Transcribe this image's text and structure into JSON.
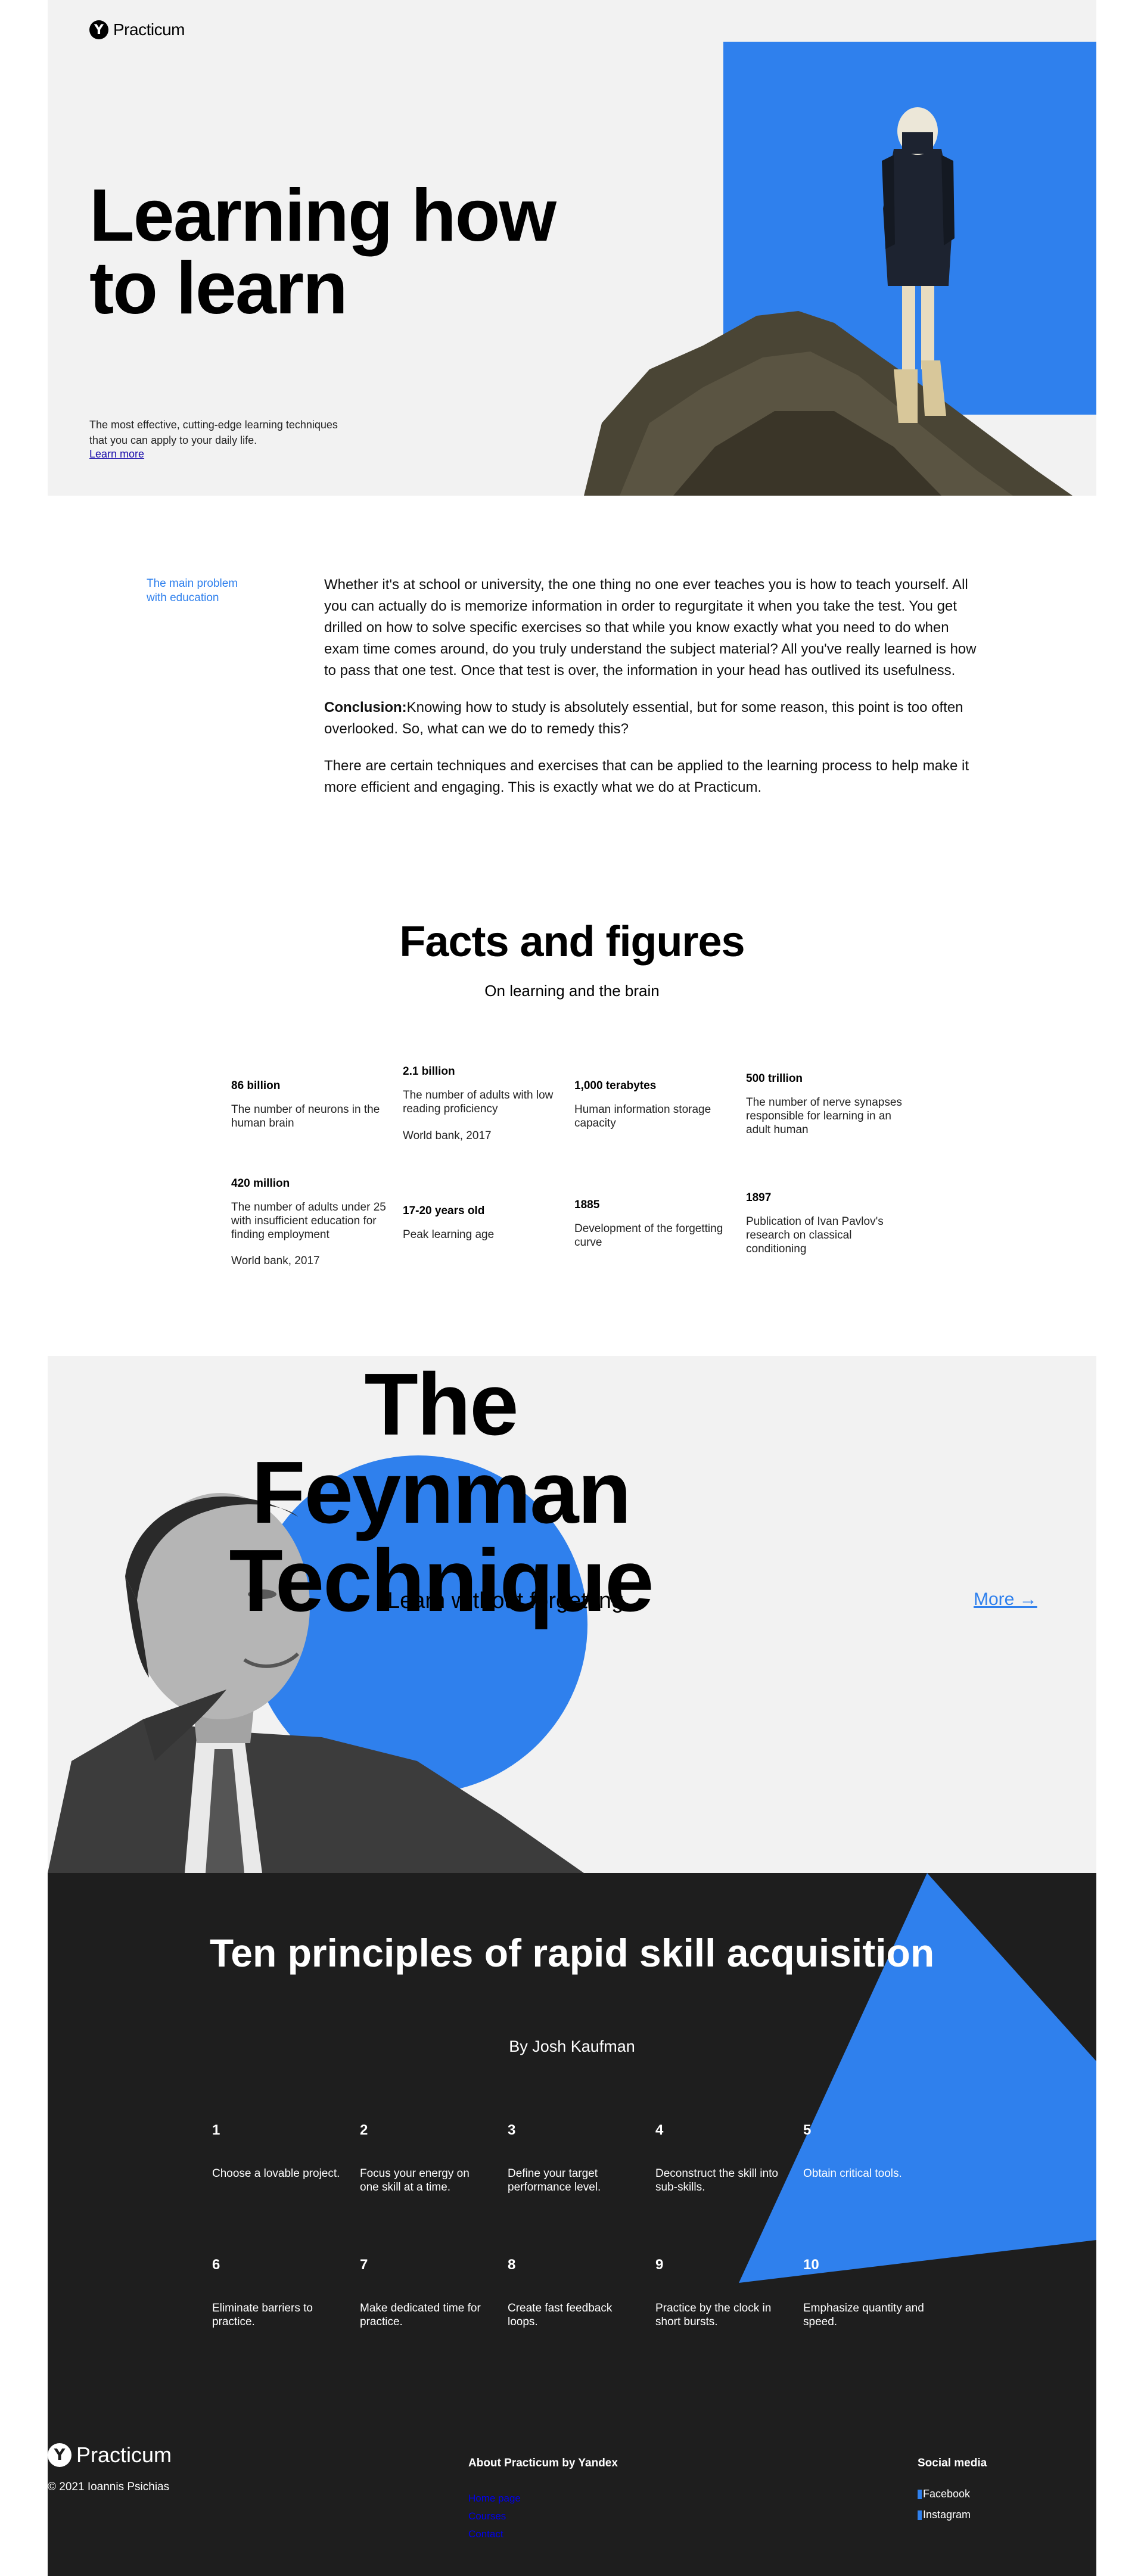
{
  "brand": {
    "name": "Practicum",
    "mark": "Y"
  },
  "hero": {
    "title": "Learning how to learn",
    "subtitle": "The most effective, cutting-edge learning techniques that you can apply to your daily life.",
    "link": "Learn more"
  },
  "problem": {
    "label": "The main problem with education",
    "p1": "Whether it's at school or university, the one thing no one ever teaches you is how to teach yourself. All you can actually do is memorize information in order to regurgitate it when you take the test. You get drilled on how to solve specific exercises so that while you know exactly what you need to do when exam time comes around, do you truly understand the subject material? All you've really learned is how to pass that one test. Once that test is over, the information in your head has outlived its usefulness.",
    "conclusion_label": "Conclusion:",
    "conclusion_text": "Knowing how to study is absolutely essential, but for some reason, this point is too often overlooked. So, what can we do to remedy this?",
    "p3": "There are certain techniques and exercises that can be applied to the learning process to help make it more efficient and engaging. This is exactly what we do at Practicum."
  },
  "facts": {
    "title": "Facts and figures",
    "subtitle": "On learning and the brain",
    "items": [
      {
        "head": "86 billion",
        "desc": "The number of neurons in the human brain",
        "source": ""
      },
      {
        "head": "2.1 billion",
        "desc": "The number of adults with low reading proficiency",
        "source": "World bank, 2017"
      },
      {
        "head": "1,000 terabytes",
        "desc": "Human information storage capacity",
        "source": ""
      },
      {
        "head": "500 trillion",
        "desc": "The number of nerve synapses responsible for learning in an adult human",
        "source": ""
      },
      {
        "head": "420 million",
        "desc": "The number of adults under 25 with insufficient education for finding employment",
        "source": "World bank, 2017"
      },
      {
        "head": "17-20 years old",
        "desc": "Peak learning age",
        "source": ""
      },
      {
        "head": "1885",
        "desc": "Development of the forgetting curve",
        "source": ""
      },
      {
        "head": "1897",
        "desc": "Publication of Ivan Pavlov's research on classical conditioning",
        "source": ""
      }
    ]
  },
  "feynman": {
    "title": "The Feynman Technique",
    "subtitle": "Learn without forgetting.",
    "more": "More →"
  },
  "principles": {
    "title": "Ten principles of rapid skill acquisition",
    "subtitle": "By Josh Kaufman",
    "items": [
      {
        "num": "1",
        "text": "Choose a lovable project."
      },
      {
        "num": "2",
        "text": "Focus your energy on one skill at a time."
      },
      {
        "num": "3",
        "text": "Define your target performance level."
      },
      {
        "num": "4",
        "text": "Deconstruct the skill into sub-skills."
      },
      {
        "num": "5",
        "text": "Obtain critical tools."
      },
      {
        "num": "6",
        "text": "Eliminate barriers to practice."
      },
      {
        "num": "7",
        "text": "Make dedicated time for practice."
      },
      {
        "num": "8",
        "text": "Create fast feedback loops."
      },
      {
        "num": "9",
        "text": "Practice by the clock in short bursts."
      },
      {
        "num": "10",
        "text": "Emphasize quantity and speed."
      }
    ]
  },
  "footer": {
    "copyright": "© 2021 Ioannis Psichias",
    "about_head": "About Practicum by Yandex",
    "about_links": [
      "Home page",
      "Courses",
      "Contact"
    ],
    "social_head": "Social media",
    "social": [
      {
        "label": "Facebook",
        "icon": "facebook-icon"
      },
      {
        "label": "Instagram",
        "icon": "instagram-icon"
      }
    ]
  },
  "colors": {
    "accent": "#2f80ed",
    "hero_bg": "#f2f2f2",
    "dark": "#1e1e1e"
  }
}
